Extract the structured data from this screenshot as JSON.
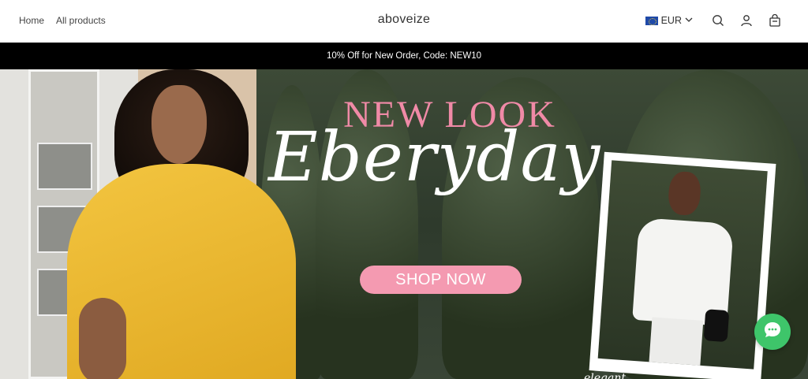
{
  "header": {
    "nav": [
      {
        "label": "Home"
      },
      {
        "label": "All products"
      }
    ],
    "logo": "aboveize",
    "currency": {
      "code": "EUR",
      "flag_icon": "eu-flag-icon",
      "dropdown_icon": "chevron-down-icon"
    },
    "icons": [
      "search-icon",
      "user-icon",
      "cart-icon"
    ]
  },
  "announcement": "10% Off for New Order, Code: NEW10",
  "hero": {
    "title_line_1": "NEW LOOK",
    "title_line_2": "Eberyday",
    "cta": "SHOP NOW",
    "photo_caption": "elegant"
  },
  "colors": {
    "announcement_bg": "#000000",
    "title_pink": "#f08aa7",
    "button_pink": "#f49ab1",
    "chat_green": "#3ec56a"
  },
  "chat": {
    "icon": "chat-bubble-icon"
  }
}
